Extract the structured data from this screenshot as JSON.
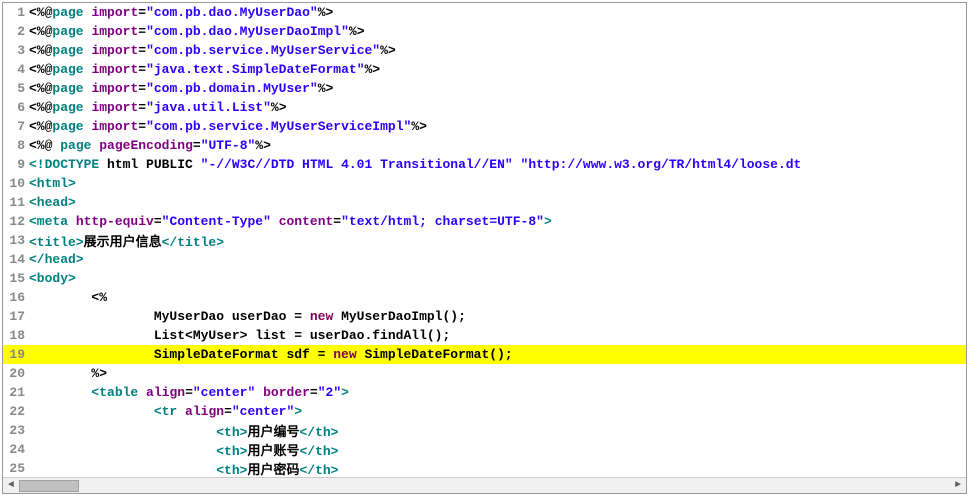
{
  "lines": [
    {
      "n": 1,
      "hl": false,
      "segs": [
        {
          "c": "txt",
          "t": "<%@"
        },
        {
          "c": "tag",
          "t": "page"
        },
        {
          "c": "txt",
          "t": " "
        },
        {
          "c": "attr",
          "t": "import"
        },
        {
          "c": "txt",
          "t": "="
        },
        {
          "c": "str",
          "t": "\"com.pb.dao.MyUserDao\""
        },
        {
          "c": "txt",
          "t": "%>"
        }
      ]
    },
    {
      "n": 2,
      "hl": false,
      "segs": [
        {
          "c": "txt",
          "t": "<%@"
        },
        {
          "c": "tag",
          "t": "page"
        },
        {
          "c": "txt",
          "t": " "
        },
        {
          "c": "attr",
          "t": "import"
        },
        {
          "c": "txt",
          "t": "="
        },
        {
          "c": "str",
          "t": "\"com.pb.dao.MyUserDaoImpl\""
        },
        {
          "c": "txt",
          "t": "%>"
        }
      ]
    },
    {
      "n": 3,
      "hl": false,
      "segs": [
        {
          "c": "txt",
          "t": "<%@"
        },
        {
          "c": "tag",
          "t": "page"
        },
        {
          "c": "txt",
          "t": " "
        },
        {
          "c": "attr",
          "t": "import"
        },
        {
          "c": "txt",
          "t": "="
        },
        {
          "c": "str",
          "t": "\"com.pb.service.MyUserService\""
        },
        {
          "c": "txt",
          "t": "%>"
        }
      ]
    },
    {
      "n": 4,
      "hl": false,
      "segs": [
        {
          "c": "txt",
          "t": "<%@"
        },
        {
          "c": "tag",
          "t": "page"
        },
        {
          "c": "txt",
          "t": " "
        },
        {
          "c": "attr",
          "t": "import"
        },
        {
          "c": "txt",
          "t": "="
        },
        {
          "c": "str",
          "t": "\"java.text.SimpleDateFormat\""
        },
        {
          "c": "txt",
          "t": "%>"
        }
      ]
    },
    {
      "n": 5,
      "hl": false,
      "segs": [
        {
          "c": "txt",
          "t": "<%@"
        },
        {
          "c": "tag",
          "t": "page"
        },
        {
          "c": "txt",
          "t": " "
        },
        {
          "c": "attr",
          "t": "import"
        },
        {
          "c": "txt",
          "t": "="
        },
        {
          "c": "str",
          "t": "\"com.pb.domain.MyUser\""
        },
        {
          "c": "txt",
          "t": "%>"
        }
      ]
    },
    {
      "n": 6,
      "hl": false,
      "segs": [
        {
          "c": "txt",
          "t": "<%@"
        },
        {
          "c": "tag",
          "t": "page"
        },
        {
          "c": "txt",
          "t": " "
        },
        {
          "c": "attr",
          "t": "import"
        },
        {
          "c": "txt",
          "t": "="
        },
        {
          "c": "str",
          "t": "\"java.util.List\""
        },
        {
          "c": "txt",
          "t": "%>"
        }
      ]
    },
    {
      "n": 7,
      "hl": false,
      "segs": [
        {
          "c": "txt",
          "t": "<%@"
        },
        {
          "c": "tag",
          "t": "page"
        },
        {
          "c": "txt",
          "t": " "
        },
        {
          "c": "attr",
          "t": "import"
        },
        {
          "c": "txt",
          "t": "="
        },
        {
          "c": "str",
          "t": "\"com.pb.service.MyUserServiceImpl\""
        },
        {
          "c": "txt",
          "t": "%>"
        }
      ]
    },
    {
      "n": 8,
      "hl": false,
      "segs": [
        {
          "c": "txt",
          "t": "<%@ "
        },
        {
          "c": "tag",
          "t": "page"
        },
        {
          "c": "txt",
          "t": " "
        },
        {
          "c": "attr",
          "t": "pageEncoding"
        },
        {
          "c": "txt",
          "t": "="
        },
        {
          "c": "str",
          "t": "\"UTF-8\""
        },
        {
          "c": "txt",
          "t": "%>"
        }
      ]
    },
    {
      "n": 9,
      "hl": false,
      "segs": [
        {
          "c": "tag",
          "t": "<!DOCTYPE "
        },
        {
          "c": "txt",
          "t": "html PUBLIC "
        },
        {
          "c": "str",
          "t": "\"-//W3C//DTD HTML 4.01 Transitional//EN\""
        },
        {
          "c": "txt",
          "t": " "
        },
        {
          "c": "str",
          "t": "\"http://www.w3.org/TR/html4/loose.dt"
        }
      ]
    },
    {
      "n": 10,
      "hl": false,
      "segs": [
        {
          "c": "tag",
          "t": "<html>"
        }
      ]
    },
    {
      "n": 11,
      "hl": false,
      "segs": [
        {
          "c": "tag",
          "t": "<head>"
        }
      ]
    },
    {
      "n": 12,
      "hl": false,
      "segs": [
        {
          "c": "tag",
          "t": "<meta"
        },
        {
          "c": "txt",
          "t": " "
        },
        {
          "c": "attr",
          "t": "http-equiv"
        },
        {
          "c": "txt",
          "t": "="
        },
        {
          "c": "str",
          "t": "\"Content-Type\""
        },
        {
          "c": "txt",
          "t": " "
        },
        {
          "c": "attr",
          "t": "content"
        },
        {
          "c": "txt",
          "t": "="
        },
        {
          "c": "str",
          "t": "\"text/html; charset=UTF-8\""
        },
        {
          "c": "tag",
          "t": ">"
        }
      ]
    },
    {
      "n": 13,
      "hl": false,
      "segs": [
        {
          "c": "tag",
          "t": "<title>"
        },
        {
          "c": "txt",
          "t": "展示用户信息"
        },
        {
          "c": "tag",
          "t": "</title>"
        }
      ]
    },
    {
      "n": 14,
      "hl": false,
      "segs": [
        {
          "c": "tag",
          "t": "</head>"
        }
      ]
    },
    {
      "n": 15,
      "hl": false,
      "segs": [
        {
          "c": "tag",
          "t": "<body>"
        }
      ]
    },
    {
      "n": 16,
      "hl": false,
      "segs": [
        {
          "c": "txt",
          "t": "        <%"
        }
      ]
    },
    {
      "n": 17,
      "hl": false,
      "segs": [
        {
          "c": "txt",
          "t": "                MyUserDao userDao = "
        },
        {
          "c": "kw",
          "t": "new"
        },
        {
          "c": "txt",
          "t": " MyUserDaoImpl();"
        }
      ]
    },
    {
      "n": 18,
      "hl": false,
      "segs": [
        {
          "c": "txt",
          "t": "                List<MyUser> list = userDao.findAll();"
        }
      ]
    },
    {
      "n": 19,
      "hl": true,
      "segs": [
        {
          "c": "txt",
          "t": "                SimpleDateFormat sdf = "
        },
        {
          "c": "kw",
          "t": "new"
        },
        {
          "c": "txt",
          "t": " SimpleDateFormat();"
        }
      ]
    },
    {
      "n": 20,
      "hl": false,
      "segs": [
        {
          "c": "txt",
          "t": "        %>"
        }
      ]
    },
    {
      "n": 21,
      "hl": false,
      "segs": [
        {
          "c": "txt",
          "t": "        "
        },
        {
          "c": "tag",
          "t": "<table"
        },
        {
          "c": "txt",
          "t": " "
        },
        {
          "c": "attr",
          "t": "align"
        },
        {
          "c": "txt",
          "t": "="
        },
        {
          "c": "str",
          "t": "\"center\""
        },
        {
          "c": "txt",
          "t": " "
        },
        {
          "c": "attr",
          "t": "border"
        },
        {
          "c": "txt",
          "t": "="
        },
        {
          "c": "str",
          "t": "\"2\""
        },
        {
          "c": "tag",
          "t": ">"
        }
      ]
    },
    {
      "n": 22,
      "hl": false,
      "segs": [
        {
          "c": "txt",
          "t": "                "
        },
        {
          "c": "tag",
          "t": "<tr"
        },
        {
          "c": "txt",
          "t": " "
        },
        {
          "c": "attr",
          "t": "align"
        },
        {
          "c": "txt",
          "t": "="
        },
        {
          "c": "str",
          "t": "\"center\""
        },
        {
          "c": "tag",
          "t": ">"
        }
      ]
    },
    {
      "n": 23,
      "hl": false,
      "segs": [
        {
          "c": "txt",
          "t": "                        "
        },
        {
          "c": "tag",
          "t": "<th>"
        },
        {
          "c": "txt",
          "t": "用户编号"
        },
        {
          "c": "tag",
          "t": "</th>"
        }
      ]
    },
    {
      "n": 24,
      "hl": false,
      "segs": [
        {
          "c": "txt",
          "t": "                        "
        },
        {
          "c": "tag",
          "t": "<th>"
        },
        {
          "c": "txt",
          "t": "用户账号"
        },
        {
          "c": "tag",
          "t": "</th>"
        }
      ]
    },
    {
      "n": 25,
      "hl": false,
      "segs": [
        {
          "c": "txt",
          "t": "                        "
        },
        {
          "c": "tag",
          "t": "<th>"
        },
        {
          "c": "txt",
          "t": "用户密码"
        },
        {
          "c": "tag",
          "t": "</th>"
        }
      ]
    }
  ],
  "scroll": {
    "left_arrow": "◄",
    "right_arrow": "►"
  }
}
